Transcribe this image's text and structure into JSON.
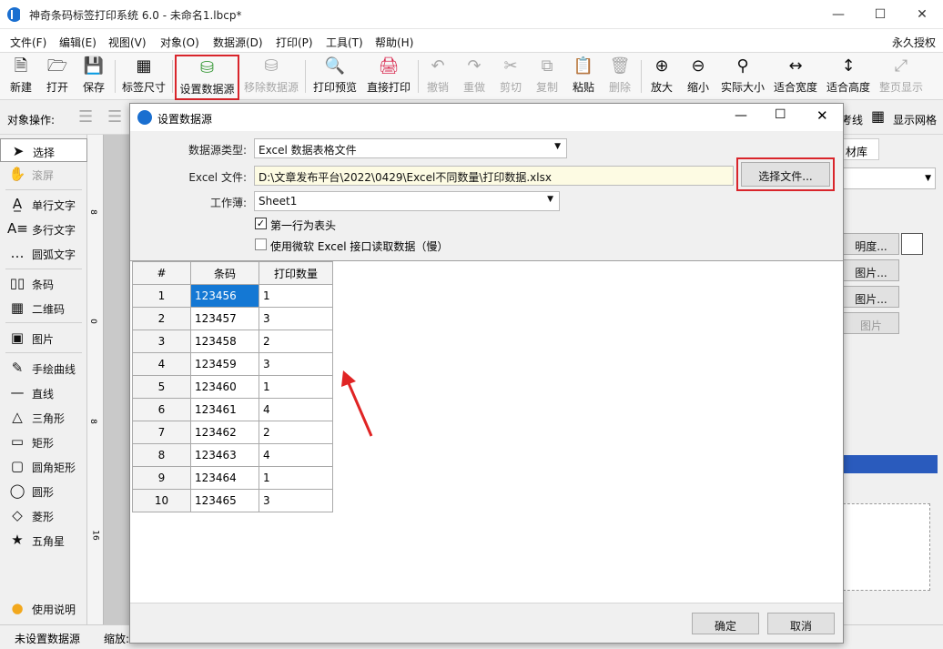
{
  "app": {
    "title": "神奇条码标签打印系统 6.0 - 未命名1.lbcp*",
    "window_controls": [
      "minimize-icon",
      "maximize-icon",
      "close-icon"
    ]
  },
  "menu": {
    "items": [
      "文件(F)",
      "编辑(E)",
      "视图(V)",
      "对象(O)",
      "数据源(D)",
      "打印(P)",
      "工具(T)",
      "帮助(H)"
    ],
    "license": "永久授权"
  },
  "toolbar": {
    "buttons": [
      {
        "label": "新建",
        "icon": "new-file-icon"
      },
      {
        "label": "打开",
        "icon": "open-icon"
      },
      {
        "label": "保存",
        "icon": "save-icon"
      },
      {
        "label": "标签尺寸",
        "icon": "label-size-icon"
      },
      {
        "label": "设置数据源",
        "icon": "database-icon"
      },
      {
        "label": "移除数据源",
        "icon": "remove-database-icon"
      },
      {
        "label": "打印预览",
        "icon": "print-preview-icon"
      },
      {
        "label": "直接打印",
        "icon": "printer-icon"
      },
      {
        "label": "撤销",
        "icon": "undo-icon"
      },
      {
        "label": "重做",
        "icon": "redo-icon"
      },
      {
        "label": "剪切",
        "icon": "cut-icon"
      },
      {
        "label": "复制",
        "icon": "copy-icon"
      },
      {
        "label": "粘贴",
        "icon": "paste-icon"
      },
      {
        "label": "删除",
        "icon": "delete-icon"
      },
      {
        "label": "放大",
        "icon": "zoom-in-icon"
      },
      {
        "label": "缩小",
        "icon": "zoom-out-icon"
      },
      {
        "label": "实际大小",
        "icon": "actual-size-icon"
      },
      {
        "label": "适合宽度",
        "icon": "fit-width-icon"
      },
      {
        "label": "适合高度",
        "icon": "fit-height-icon"
      },
      {
        "label": "整页显示",
        "icon": "full-page-icon"
      }
    ]
  },
  "objbar": {
    "label": "对象操作:",
    "guide_partial": "考线",
    "show_grid": "显示网格"
  },
  "tools": {
    "items": [
      {
        "label": "选择",
        "icon": "pointer-icon"
      },
      {
        "label": "滚屏",
        "icon": "hand-icon"
      },
      {
        "label": "单行文字",
        "icon": "single-line-text-icon"
      },
      {
        "label": "多行文字",
        "icon": "multi-line-text-icon"
      },
      {
        "label": "圆弧文字",
        "icon": "arc-text-icon"
      },
      {
        "label": "条码",
        "icon": "barcode-icon"
      },
      {
        "label": "二维码",
        "icon": "qrcode-icon"
      },
      {
        "label": "图片",
        "icon": "image-icon"
      },
      {
        "label": "手绘曲线",
        "icon": "pen-icon"
      },
      {
        "label": "直线",
        "icon": "line-icon"
      },
      {
        "label": "三角形",
        "icon": "triangle-icon"
      },
      {
        "label": "矩形",
        "icon": "rectangle-icon"
      },
      {
        "label": "圆角矩形",
        "icon": "rounded-rectangle-icon"
      },
      {
        "label": "圆形",
        "icon": "circle-icon"
      },
      {
        "label": "菱形",
        "icon": "diamond-icon"
      },
      {
        "label": "五角星",
        "icon": "star-icon"
      },
      {
        "label": "使用说明",
        "icon": "lightbulb-icon"
      }
    ]
  },
  "ruler": {
    "marks": [
      "8",
      "0",
      "8",
      "16"
    ]
  },
  "rightpanel": {
    "tab": "材库",
    "buttons": [
      "明度...",
      "图片...",
      "图片...",
      "图片"
    ]
  },
  "status": {
    "datasource": "未设置数据源",
    "zoom": "缩放:"
  },
  "dialog": {
    "title": "设置数据源",
    "source_type_label": "数据源类型:",
    "source_type_value": "Excel 数据表格文件",
    "file_label": "Excel 文件:",
    "file_value": "D:\\文章发布平台\\2022\\0429\\Excel不同数量\\打印数据.xlsx",
    "choose_file": "选择文件...",
    "sheet_label": "工作薄:",
    "sheet_value": "Sheet1",
    "first_row_header": "第一行为表头",
    "use_ms_excel": "使用微软 Excel 接口读取数据（慢）",
    "columns": [
      "#",
      "条码",
      "打印数量"
    ],
    "rows": [
      [
        "1",
        "123456",
        "1"
      ],
      [
        "2",
        "123457",
        "3"
      ],
      [
        "3",
        "123458",
        "2"
      ],
      [
        "4",
        "123459",
        "3"
      ],
      [
        "5",
        "123460",
        "1"
      ],
      [
        "6",
        "123461",
        "4"
      ],
      [
        "7",
        "123462",
        "2"
      ],
      [
        "8",
        "123463",
        "4"
      ],
      [
        "9",
        "123464",
        "1"
      ],
      [
        "10",
        "123465",
        "3"
      ]
    ],
    "ok": "确定",
    "cancel": "取消"
  }
}
